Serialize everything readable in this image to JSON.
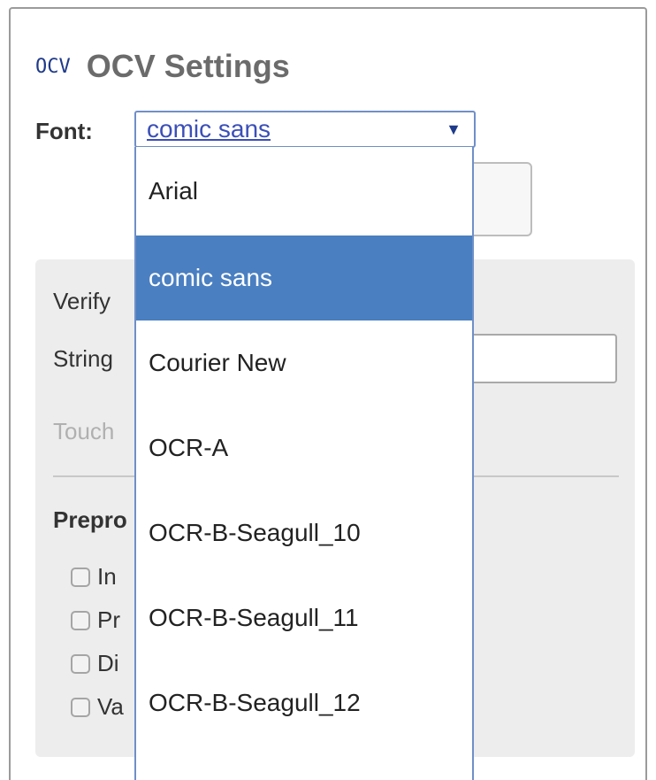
{
  "header": {
    "logo": "OCV",
    "title": "OCV Settings"
  },
  "font": {
    "label": "Font:",
    "selected": "comic sans",
    "options": [
      "Arial",
      "comic sans",
      "Courier New",
      "OCR-A",
      "OCR-B-Seagull_10",
      "OCR-B-Seagull_11",
      "OCR-B-Seagull_12"
    ]
  },
  "settings": {
    "verify_label": "Verify",
    "string_label": "String",
    "touch_label": "Touch",
    "preprocess_label": "Prepro",
    "checkboxes": [
      "In",
      "Pr",
      "Di",
      "Va"
    ]
  },
  "colors": {
    "selected_bg": "#4a7fc1",
    "link": "#3b4fb8"
  }
}
